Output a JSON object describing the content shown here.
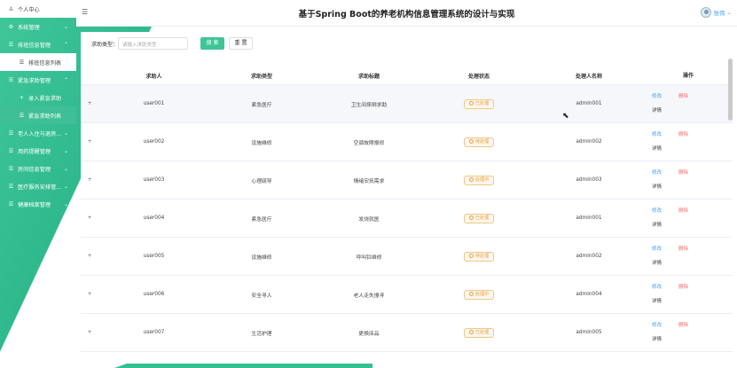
{
  "app_title": "基于Spring Boot的养老机构信息管理系统的设计与实现",
  "header_user": "张伟",
  "sidebar": {
    "items": [
      {
        "label": "个人中心",
        "icon": "user-icon",
        "type": "user"
      },
      {
        "label": "系统管理",
        "icon": "gear-icon",
        "chev": "⌄"
      },
      {
        "label": "排班信息管理",
        "icon": "list-icon",
        "chev": "⌃"
      },
      {
        "label": "排班信息列表",
        "icon": "list-icon",
        "sub": true,
        "type": "white"
      },
      {
        "label": "紧急求助管理",
        "icon": "list-icon",
        "chev": "⌃"
      },
      {
        "label": "录入紧急求助",
        "icon": "plus-icon",
        "sub": true
      },
      {
        "label": "紧急求助列表",
        "icon": "list-icon",
        "sub": true,
        "active": true
      },
      {
        "label": "老人入住与退房...",
        "icon": "list-icon",
        "chev": "⌄"
      },
      {
        "label": "用药提醒管理",
        "icon": "list-icon",
        "chev": "⌄"
      },
      {
        "label": "房间信息管理",
        "icon": "list-icon",
        "chev": "⌄"
      },
      {
        "label": "医疗服务安排管...",
        "icon": "list-icon",
        "chev": "⌄"
      },
      {
        "label": "健康档案管理",
        "icon": "list-icon",
        "chev": "⌄"
      }
    ]
  },
  "search": {
    "label": "求助类型：",
    "placeholder": "请输入求助类型",
    "search_label": "搜 索",
    "reset_label": "重 置"
  },
  "table": {
    "headers": [
      "求助人",
      "求助类型",
      "求助标题",
      "处理状态",
      "处理人名称",
      "操作"
    ],
    "rows": [
      {
        "expand": "+",
        "user": "user001",
        "type": "紧急医疗",
        "title": "卫生间摔倒求助",
        "status": "已处理",
        "handler": "admin001"
      },
      {
        "expand": "+",
        "user": "user002",
        "type": "设施维修",
        "title": "空调故障报修",
        "status": "待处理",
        "handler": "admin002"
      },
      {
        "expand": "+",
        "user": "user003",
        "type": "心理疏导",
        "title": "情绪安抚需求",
        "status": "处理中",
        "handler": "admin003"
      },
      {
        "expand": "+",
        "user": "user004",
        "type": "紧急医疗",
        "title": "发烧就医",
        "status": "已处理",
        "handler": "admin001"
      },
      {
        "expand": "+",
        "user": "user005",
        "type": "设施维修",
        "title": "呼叫铃维修",
        "status": "待处理",
        "handler": "admin002"
      },
      {
        "expand": "+",
        "user": "user006",
        "type": "安全寻人",
        "title": "老人走失搜寻",
        "status": "处理中",
        "handler": "admin004"
      },
      {
        "expand": "+",
        "user": "user007",
        "type": "生活护理",
        "title": "更换床品",
        "status": "已处理",
        "handler": "admin005"
      }
    ],
    "actions": {
      "edit": "修改",
      "delete": "删除",
      "detail": "详情"
    }
  },
  "colors": {
    "accent": "#3ec596",
    "link": "#409eff",
    "danger": "#f56c6c",
    "warning": "#e6a23c"
  }
}
